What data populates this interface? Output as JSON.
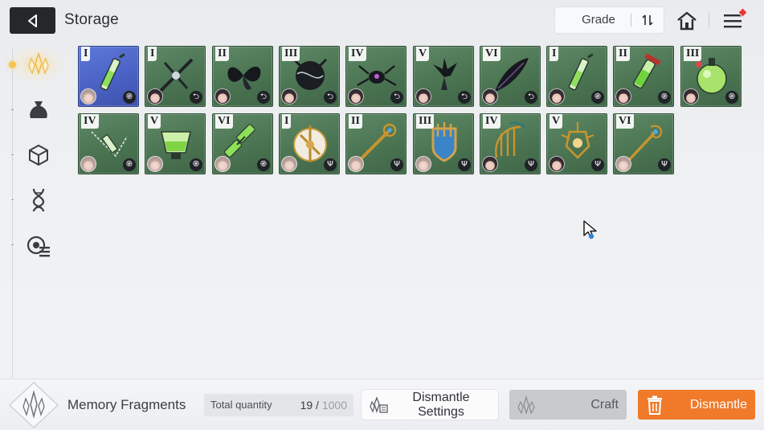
{
  "header": {
    "title": "Storage",
    "sort_label": "Grade"
  },
  "sidebar": {
    "items": [
      {
        "icon": "memory-fragment-icon",
        "active": true
      },
      {
        "icon": "bag-icon",
        "active": false
      },
      {
        "icon": "cube-icon",
        "active": false
      },
      {
        "icon": "dna-icon",
        "active": false
      },
      {
        "icon": "disc-list-icon",
        "active": false
      }
    ]
  },
  "items": [
    {
      "grade": "I",
      "rarity": "blue",
      "art": "syringe",
      "type": "swirl",
      "avatar": "light"
    },
    {
      "grade": "I",
      "rarity": "green",
      "art": "needle",
      "type": "claw",
      "avatar": "dark"
    },
    {
      "grade": "II",
      "rarity": "green",
      "art": "dark-petals",
      "type": "claw",
      "avatar": "dark"
    },
    {
      "grade": "III",
      "rarity": "green",
      "art": "dark-orb",
      "type": "claw",
      "avatar": "dark"
    },
    {
      "grade": "IV",
      "rarity": "green",
      "art": "spider",
      "type": "claw",
      "avatar": "dark"
    },
    {
      "grade": "V",
      "rarity": "green",
      "art": "dark-flower",
      "type": "claw",
      "avatar": "dark"
    },
    {
      "grade": "VI",
      "rarity": "green",
      "art": "dark-feather",
      "type": "claw",
      "avatar": "dark"
    },
    {
      "grade": "I",
      "rarity": "green",
      "art": "syringe",
      "type": "swirl",
      "avatar": "dark"
    },
    {
      "grade": "II",
      "rarity": "green",
      "art": "green-vial",
      "type": "swirl",
      "avatar": "dark"
    },
    {
      "grade": "III",
      "rarity": "green",
      "art": "green-flask",
      "type": "swirl",
      "avatar": "dark"
    },
    {
      "grade": "IV",
      "rarity": "green",
      "art": "tube-chain",
      "type": "swirl",
      "avatar": "light"
    },
    {
      "grade": "V",
      "rarity": "green",
      "art": "green-cup",
      "type": "swirl",
      "avatar": "light"
    },
    {
      "grade": "VI",
      "rarity": "green",
      "art": "green-tubes",
      "type": "swirl",
      "avatar": "light"
    },
    {
      "grade": "I",
      "rarity": "green",
      "art": "gold-shield",
      "type": "trident",
      "avatar": "light"
    },
    {
      "grade": "II",
      "rarity": "green",
      "art": "gold-staff",
      "type": "trident",
      "avatar": "light"
    },
    {
      "grade": "III",
      "rarity": "green",
      "art": "blue-crest",
      "type": "trident",
      "avatar": "light"
    },
    {
      "grade": "IV",
      "rarity": "green",
      "art": "gold-harp",
      "type": "trident",
      "avatar": "dark"
    },
    {
      "grade": "V",
      "rarity": "green",
      "art": "gold-lantern",
      "type": "trident",
      "avatar": "dark"
    },
    {
      "grade": "VI",
      "rarity": "green",
      "art": "gold-wand",
      "type": "trident",
      "avatar": "light"
    }
  ],
  "footer": {
    "fragments_label": "Memory Fragments",
    "total_label": "Total quantity",
    "total_current": "19",
    "total_sep": " / ",
    "total_max": "1000",
    "dismantle_settings_label": "Dismantle Settings",
    "craft_label": "Craft",
    "dismantle_label": "Dismantle"
  },
  "colors": {
    "accent_orange": "#f07a2a",
    "header_dark": "#25272b",
    "card_green": "#4b7452",
    "card_blue": "#4a62c4"
  }
}
